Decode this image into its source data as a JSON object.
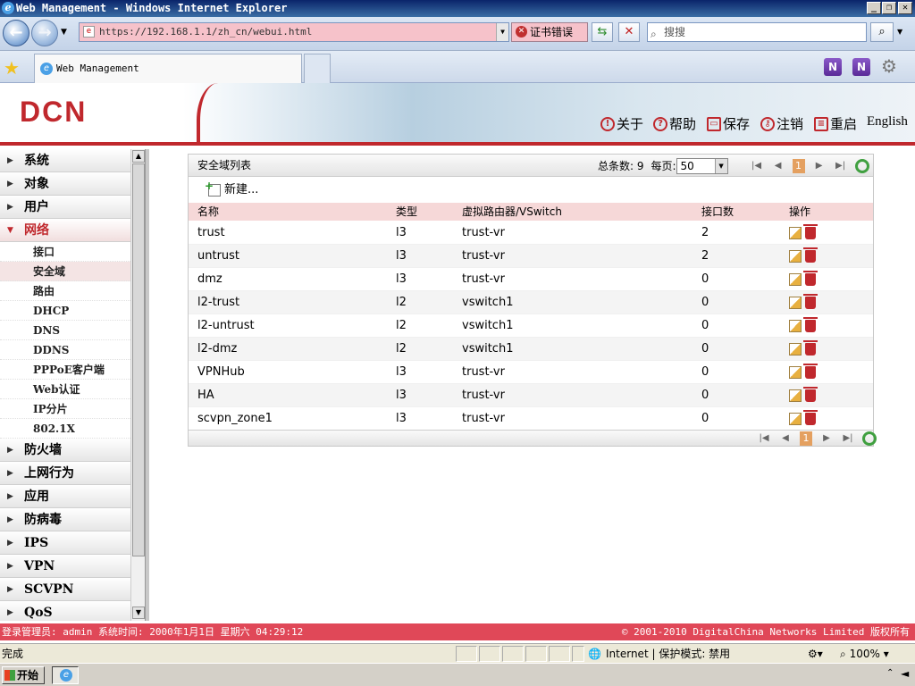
{
  "window": {
    "title": "Web Management - Windows Internet Explorer"
  },
  "browser": {
    "url": "https://192.168.1.1/zh_cn/webui.html",
    "cert_error": "证书错误",
    "search_placeholder": "搜搜",
    "tab_title": "Web Management",
    "zoom": "100%",
    "status_text": "完成",
    "zone": "Internet | 保护模式: 禁用"
  },
  "header": {
    "logo": "DCN",
    "links": [
      {
        "label": "关于",
        "icon": "info-icon"
      },
      {
        "label": "帮助",
        "icon": "help-icon"
      },
      {
        "label": "保存",
        "icon": "save-icon"
      },
      {
        "label": "注销",
        "icon": "logout-key-icon"
      },
      {
        "label": "重启",
        "icon": "restart-icon"
      },
      {
        "label": "English",
        "icon": ""
      }
    ]
  },
  "sidebar": {
    "menus_top": [
      "系统",
      "对象",
      "用户"
    ],
    "open_menu": "网络",
    "submenu": [
      "接口",
      "安全域",
      "路由",
      "DHCP",
      "DNS",
      "DDNS",
      "PPPoE客户端",
      "Web认证",
      "IP分片",
      "802.1X"
    ],
    "active_submenu": "安全域",
    "menus_bottom": [
      "防火墙",
      "上网行为",
      "应用",
      "防病毒",
      "IPS",
      "VPN",
      "SCVPN",
      "QoS"
    ]
  },
  "panel": {
    "title": "安全域列表",
    "total_label": "总条数: 9",
    "per_page_label": "每页:",
    "per_page": "50",
    "current_page": "1",
    "new_label": "新建...",
    "columns": [
      "名称",
      "类型",
      "虚拟路由器/VSwitch",
      "接口数",
      "操作"
    ],
    "rows": [
      [
        "trust",
        "l3",
        "trust-vr",
        "2"
      ],
      [
        "untrust",
        "l3",
        "trust-vr",
        "2"
      ],
      [
        "dmz",
        "l3",
        "trust-vr",
        "0"
      ],
      [
        "l2-trust",
        "l2",
        "vswitch1",
        "0"
      ],
      [
        "l2-untrust",
        "l2",
        "vswitch1",
        "0"
      ],
      [
        "l2-dmz",
        "l2",
        "vswitch1",
        "0"
      ],
      [
        "VPNHub",
        "l3",
        "trust-vr",
        "0"
      ],
      [
        "HA",
        "l3",
        "trust-vr",
        "0"
      ],
      [
        "scvpn_zone1",
        "l3",
        "trust-vr",
        "0"
      ]
    ]
  },
  "footer": {
    "left": "登录管理员: admin 系统时间: 2000年1月1日 星期六 04:29:12",
    "right": "© 2001-2010 DigitalChina Networks Limited 版权所有"
  },
  "taskbar": {
    "start": "开始"
  },
  "colors": {
    "brand_red": "#c0282d",
    "footer_red": "#e04858",
    "header_pink": "#f6d8d8"
  }
}
